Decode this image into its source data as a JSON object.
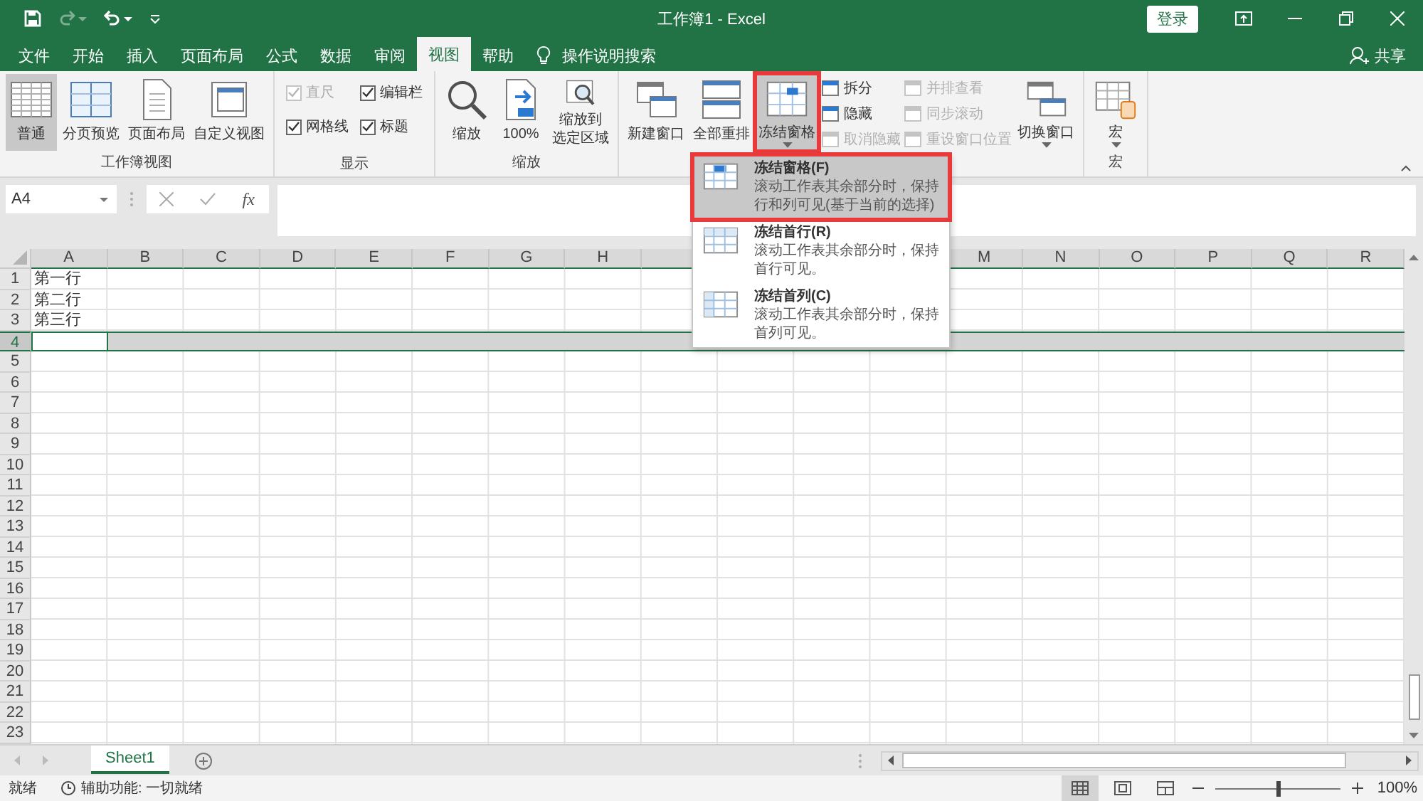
{
  "title_bar": {
    "quick_access": [
      {
        "kind": "save",
        "disabled": false
      },
      {
        "kind": "redo",
        "disabled": true
      },
      {
        "kind": "undo",
        "disabled": false
      },
      {
        "kind": "customize",
        "disabled": false
      }
    ],
    "title": "工作簿1 - Excel",
    "sign_in": "登录"
  },
  "tabs": [
    {
      "label": "文件",
      "selected": false
    },
    {
      "label": "开始",
      "selected": false
    },
    {
      "label": "插入",
      "selected": false
    },
    {
      "label": "页面布局",
      "selected": false
    },
    {
      "label": "公式",
      "selected": false
    },
    {
      "label": "数据",
      "selected": false
    },
    {
      "label": "审阅",
      "selected": false
    },
    {
      "label": "视图",
      "selected": true
    },
    {
      "label": "帮助",
      "selected": false
    }
  ],
  "tell_me": "操作说明搜索",
  "share": "共享",
  "ribbon": {
    "groups": [
      {
        "label": "工作簿视图",
        "items": [
          {
            "kind": "large",
            "label": "普通",
            "selected": true
          },
          {
            "kind": "large",
            "label": "分页预览",
            "selected": false
          },
          {
            "kind": "large",
            "label": "页面布局",
            "selected": false
          },
          {
            "kind": "large",
            "label": "自定义视图",
            "selected": false
          }
        ]
      },
      {
        "label": "显示",
        "items": [
          {
            "kind": "check",
            "label": "直尺",
            "checked": true,
            "disabled": true
          },
          {
            "kind": "check",
            "label": "编辑栏",
            "checked": true,
            "disabled": false
          },
          {
            "kind": "check",
            "label": "网格线",
            "checked": true,
            "disabled": false
          },
          {
            "kind": "check",
            "label": "标题",
            "checked": true,
            "disabled": false
          }
        ]
      },
      {
        "label": "缩放",
        "items": [
          {
            "kind": "large",
            "label": "缩放"
          },
          {
            "kind": "large",
            "label": "100%"
          },
          {
            "kind": "large",
            "lines": [
              "缩放到",
              "选定区域"
            ]
          }
        ]
      },
      {
        "items": [
          {
            "kind": "large",
            "label": "新建窗口"
          },
          {
            "kind": "large",
            "label": "全部重排"
          },
          {
            "kind": "large",
            "label": "冻结窗格",
            "dropdown": true,
            "open": true,
            "highlighted": true
          },
          {
            "kind": "stack",
            "items": [
              {
                "label": "拆分",
                "disabled": false
              },
              {
                "label": "隐藏",
                "disabled": false
              },
              {
                "label": "取消隐藏",
                "disabled": true
              }
            ]
          },
          {
            "kind": "stack",
            "items": [
              {
                "label": "并排查看",
                "disabled": true
              },
              {
                "label": "同步滚动",
                "disabled": true
              },
              {
                "label": "重设窗口位置",
                "disabled": true
              }
            ]
          },
          {
            "kind": "large",
            "label": "切换窗口",
            "dropdown": true
          }
        ]
      },
      {
        "label": "宏",
        "items": [
          {
            "kind": "large",
            "label": "宏",
            "dropdown": true
          }
        ]
      }
    ]
  },
  "formula_bar": {
    "name_box": "A4",
    "function_button": "fx"
  },
  "sheet": {
    "columns": [
      {
        "label": "A"
      },
      {
        "label": "B"
      },
      {
        "label": "C"
      },
      {
        "label": "D"
      },
      {
        "label": "E"
      },
      {
        "label": "F"
      },
      {
        "label": "G"
      },
      {
        "label": "H"
      },
      {},
      {},
      {},
      {},
      {
        "label": "M"
      },
      {
        "label": "N"
      },
      {
        "label": "O"
      },
      {
        "label": "P"
      },
      {
        "label": "Q"
      },
      {
        "label": "R"
      }
    ],
    "rows": [
      {
        "header": "1",
        "selected": false,
        "cells": [
          {
            "text": "第一行"
          }
        ]
      },
      {
        "header": "2",
        "selected": false,
        "cells": [
          {
            "text": "第二行"
          }
        ]
      },
      {
        "header": "3",
        "selected": false,
        "cells": [
          {
            "text": "第三行"
          }
        ]
      },
      {
        "header": "4",
        "selected": true,
        "cells": [
          {
            "active": true
          }
        ]
      },
      {
        "header": "5",
        "selected": false
      },
      {
        "header": "6",
        "selected": false
      },
      {
        "header": "7",
        "selected": false
      },
      {
        "header": "8",
        "selected": false
      },
      {
        "header": "9",
        "selected": false
      },
      {
        "header": "10",
        "selected": false
      },
      {
        "header": "11",
        "selected": false
      },
      {
        "header": "12",
        "selected": false
      },
      {
        "header": "13",
        "selected": false
      },
      {
        "header": "14",
        "selected": false
      },
      {
        "header": "15",
        "selected": false
      },
      {
        "header": "16",
        "selected": false
      },
      {
        "header": "17",
        "selected": false
      },
      {
        "header": "18",
        "selected": false
      },
      {
        "header": "19",
        "selected": false
      },
      {
        "header": "20",
        "selected": false
      },
      {
        "header": "21",
        "selected": false
      },
      {
        "header": "22",
        "selected": false
      },
      {
        "header": "23",
        "selected": false
      }
    ]
  },
  "freeze_menu": {
    "items": [
      {
        "title": "冻结窗格(F)",
        "description": "滚动工作表其余部分时，保持行和列可见(基于当前的选择)",
        "selected": true,
        "highlighted": true
      },
      {
        "title": "冻结首行(R)",
        "description": "滚动工作表其余部分时，保持首行可见。",
        "selected": false
      },
      {
        "title": "冻结首列(C)",
        "description": "滚动工作表其余部分时，保持首列可见。",
        "selected": false
      }
    ]
  },
  "sheet_tabs": [
    {
      "label": "Sheet1",
      "selected": true
    }
  ],
  "status_bar": {
    "status": "就绪",
    "accessibility": "辅助功能: 一切就绪",
    "views": [
      {
        "kind": "normal",
        "selected": true
      },
      {
        "kind": "page-layout",
        "selected": false
      },
      {
        "kind": "page-break",
        "selected": false
      }
    ],
    "zoom": {
      "level": 0.5,
      "reading": "100%"
    }
  }
}
